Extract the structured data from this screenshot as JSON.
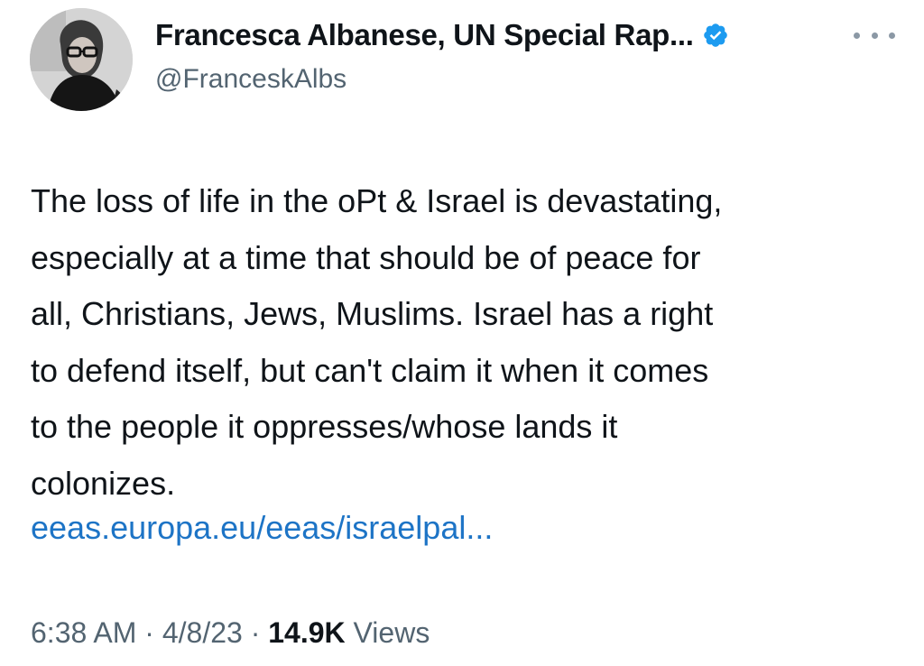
{
  "author": {
    "display_name": "Francesca Albanese, UN Special Rap...",
    "handle": "@FranceskAlbs",
    "verified_icon": "verified-badge-icon",
    "avatar": "profile-photo"
  },
  "tweet": {
    "lines": [
      "The loss of life in the oPt & Israel is devastating,",
      "especially at a time that should be of peace for",
      "all, Christians, Jews, Muslims. Israel has a right",
      "to defend itself, but can't claim it when it comes",
      "to the people it oppresses/whose lands it",
      "colonizes."
    ],
    "link_text": "eeas.europa.eu/eeas/israelpal..."
  },
  "meta": {
    "time": "6:38 AM",
    "sep1": " · ",
    "date": "4/8/23",
    "sep2": " · ",
    "views_count": "14.9K",
    "views_label": " Views"
  },
  "colors": {
    "text": "#0f1419",
    "secondary": "#536471",
    "link": "#1d74c6",
    "verified": "#1d9bf0"
  }
}
